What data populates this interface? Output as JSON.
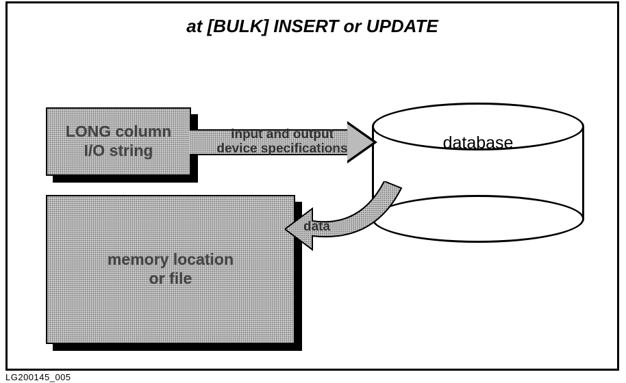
{
  "title": "at [BULK] INSERT or UPDATE",
  "long_box": {
    "line1": "LONG column",
    "line2": "I/O string"
  },
  "mem_box": {
    "line1": "memory location",
    "line2": "or file"
  },
  "database": {
    "label": "database"
  },
  "arrow1": {
    "line1": "input and output",
    "line2": "device specifications"
  },
  "arrow2": {
    "label": "data"
  },
  "footer_id": "LG200145_005"
}
